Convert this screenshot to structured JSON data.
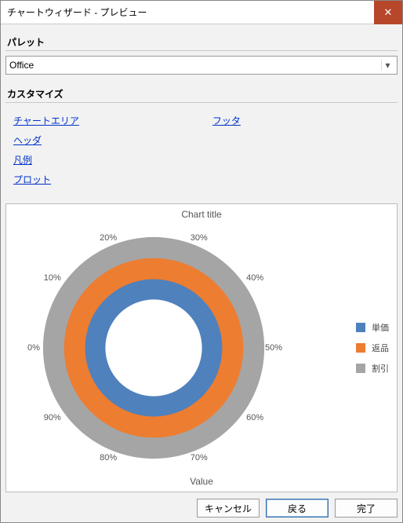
{
  "window": {
    "title": "チャートウィザード - プレビュー"
  },
  "sections": {
    "palette": "パレット",
    "customize": "カスタマイズ"
  },
  "palette": {
    "selected": "Office"
  },
  "links": {
    "col1": [
      "チャートエリア",
      "ヘッダ",
      "凡例",
      "プロット"
    ],
    "col2": [
      "フッタ"
    ]
  },
  "chart": {
    "title": "Chart title",
    "value_label": "Value",
    "ticks": [
      "0%",
      "10%",
      "20%",
      "30%",
      "40%",
      "50%",
      "60%",
      "70%",
      "80%",
      "90%"
    ],
    "legend": [
      {
        "label": "単価",
        "color": "#4f81bd"
      },
      {
        "label": "返品",
        "color": "#ed7d31"
      },
      {
        "label": "割引",
        "color": "#a5a5a5"
      }
    ]
  },
  "buttons": {
    "cancel": "キャンセル",
    "back": "戻る",
    "finish": "完了"
  },
  "chart_data": {
    "type": "pie",
    "title": "Chart title",
    "xlabel": "",
    "ylabel": "Value",
    "series": [
      {
        "name": "単価",
        "values": [
          100
        ],
        "color": "#4f81bd"
      },
      {
        "name": "返品",
        "values": [
          100
        ],
        "color": "#ed7d31"
      },
      {
        "name": "割引",
        "values": [
          100
        ],
        "color": "#a5a5a5"
      }
    ],
    "tick_labels": [
      "0%",
      "10%",
      "20%",
      "30%",
      "40%",
      "50%",
      "60%",
      "70%",
      "80%",
      "90%"
    ],
    "note": "Concentric full-circle donut rings; each series forms a complete 360° ring."
  }
}
